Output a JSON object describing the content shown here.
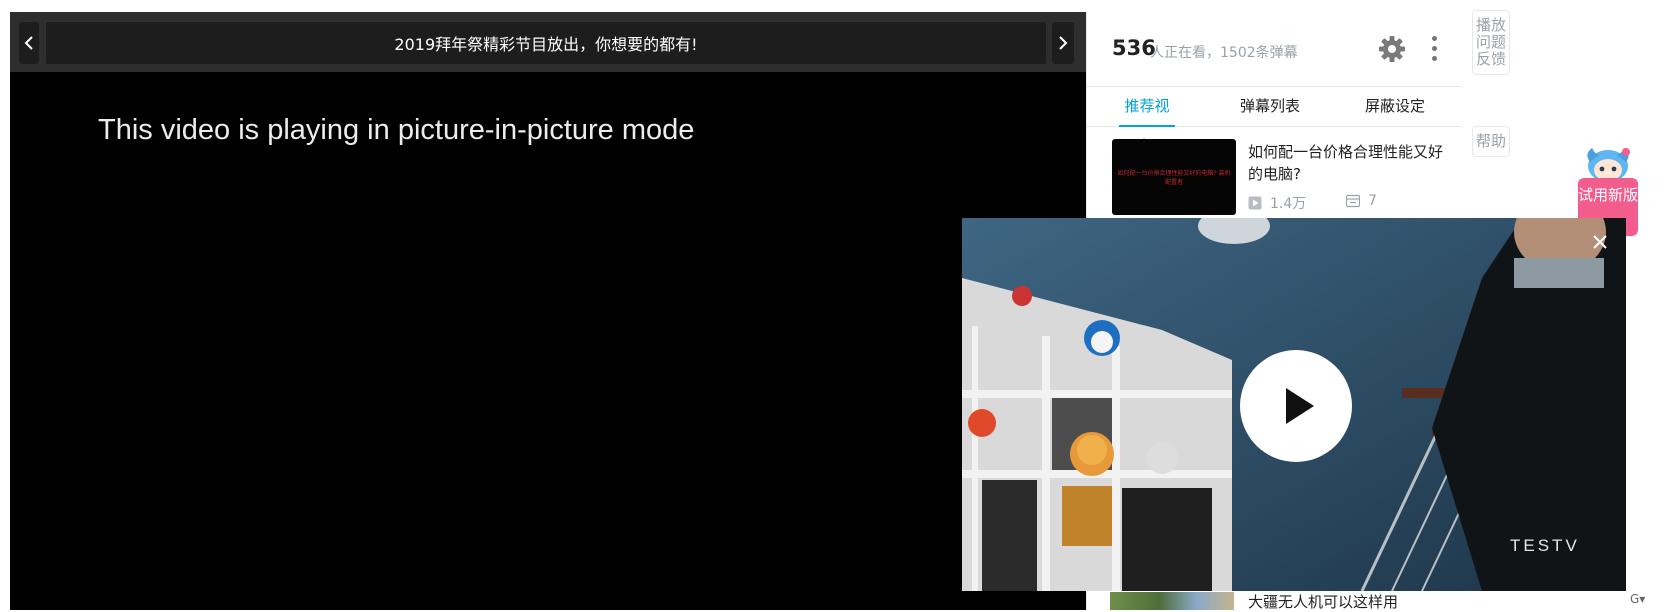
{
  "player": {
    "banner_text": "2019拜年祭精彩节目放出，你想要的都有!",
    "prev_icon": "chevron-left-icon",
    "next_icon": "chevron-right-icon",
    "pip_message": "This video is playing in picture-in-picture mode"
  },
  "panel": {
    "viewer_count": "536",
    "viewer_text": "人正在看，1502条弹幕",
    "tabs": [
      {
        "label": "推荐视频",
        "active": true
      },
      {
        "label": "弹幕列表",
        "active": false
      },
      {
        "label": "屏蔽设定",
        "active": false
      }
    ],
    "recommendations": [
      {
        "title": "如何配一台价格合理性能又好的电脑?",
        "thumb_text": "如何配一台价格合理性能又好的电脑? 装机配置者",
        "plays": "1.4万",
        "danmaku": "7"
      }
    ],
    "bottom_rec_title": "大疆无人机可以这样用"
  },
  "side": {
    "feedback_label": "播放问题反馈",
    "help_label": "帮助",
    "try_new_label": "试用新版"
  },
  "pip": {
    "logo_text": "TESTV",
    "colors": {
      "wall": "#2c4b63",
      "shelf": "#e8e8e8"
    }
  },
  "colors": {
    "accent": "#00a1d6",
    "pink": "#f25d8e",
    "muted": "#99a2aa"
  }
}
